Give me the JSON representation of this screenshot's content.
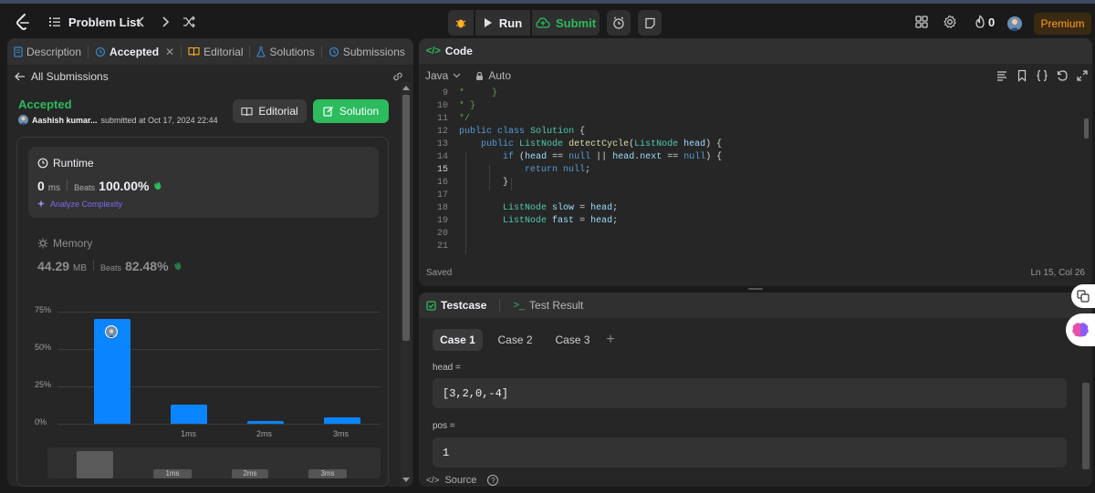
{
  "nav": {
    "problem_list": "Problem List",
    "run": "Run",
    "submit": "Submit",
    "streak": "0",
    "premium": "Premium"
  },
  "left": {
    "tabs": {
      "description": "Description",
      "accepted": "Accepted",
      "editorial": "Editorial",
      "solutions": "Solutions",
      "submissions": "Submissions"
    },
    "all_submissions": "All Submissions",
    "status": "Accepted",
    "user": "Aashish kumar...",
    "submitted": "submitted at Oct 17, 2024 22:44",
    "editorial_btn": "Editorial",
    "solution_btn": "Solution",
    "runtime": {
      "title": "Runtime",
      "value": "0",
      "unit": "ms",
      "beats_label": "Beats",
      "beats": "100.00%",
      "analyze": "Analyze Complexity"
    },
    "memory": {
      "title": "Memory",
      "value": "44.29",
      "unit": "MB",
      "beats_label": "Beats",
      "beats": "82.48%"
    }
  },
  "chart_data": {
    "type": "bar",
    "yticks": [
      "75%",
      "50%",
      "25%",
      "0%"
    ],
    "ylim": [
      0,
      75
    ],
    "categories": [
      "",
      "1ms",
      "2ms",
      "3ms"
    ],
    "values": [
      70,
      13,
      2,
      4
    ],
    "mini_labels": [
      "1ms",
      "2ms",
      "3ms"
    ],
    "bar_color": "#0b84ff"
  },
  "code": {
    "title": "Code",
    "language": "Java",
    "autocomplete": "Auto",
    "saved": "Saved",
    "cursor": "Ln 15, Col 26",
    "lines": [
      {
        "n": "9",
        "t": "*     }"
      },
      {
        "n": "10",
        "t": "* }"
      },
      {
        "n": "11",
        "t": "*/"
      },
      {
        "n": "12",
        "t": "public class Solution {"
      },
      {
        "n": "13",
        "t": "    public ListNode detectCycle(ListNode head) {"
      },
      {
        "n": "14",
        "t": "        if (head == null || head.next == null) {"
      },
      {
        "n": "15",
        "t": "            return null;"
      },
      {
        "n": "16",
        "t": "        }"
      },
      {
        "n": "17",
        "t": ""
      },
      {
        "n": "18",
        "t": "        ListNode slow = head;"
      },
      {
        "n": "19",
        "t": "        ListNode fast = head;"
      },
      {
        "n": "20",
        "t": ""
      },
      {
        "n": "21",
        "t": ""
      }
    ]
  },
  "testcase": {
    "tab": "Testcase",
    "result_tab": "Test Result",
    "cases": [
      "Case 1",
      "Case 2",
      "Case 3"
    ],
    "plus": "+",
    "head_label": "head =",
    "head_value": "[3,2,0,-4]",
    "pos_label": "pos =",
    "pos_value": "1",
    "source": "Source"
  }
}
